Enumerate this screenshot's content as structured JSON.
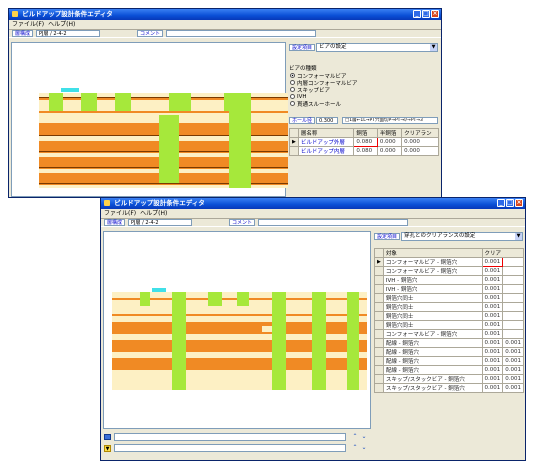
{
  "colors": {
    "copper": "#f08a24",
    "substrate": "#fdf0c4",
    "via": "#a6e83b",
    "stripe": "#7a3a00",
    "highlight": "#40e0e8"
  },
  "win1": {
    "title": "ビルドアップ設計条件エディタ",
    "menu": [
      "ファイル(F)",
      "ヘルプ(H)"
    ],
    "toolbar": {
      "tag": "層構成",
      "path": "PJ層 / 2-4-2",
      "comment_label": "コメント"
    },
    "right": {
      "setting_label": "設定項目",
      "setting_value": "ビアの設定",
      "via_group": "ビアの種類",
      "via_options": [
        "コンフォーマルビア",
        "内層コンフォーマルビア",
        "スキップビア",
        "IVH",
        "貫通スルーホール"
      ],
      "hole_label": "ホール径",
      "hole_value": "0.300",
      "hole_note": "□1層←1L→PT穴面切P→PT→I/→PT→3",
      "table_headers": [
        "層名称",
        "銅箔",
        "半銅箔",
        "クリアラン"
      ],
      "rows": [
        {
          "name": "ビルドアップ外層",
          "c1": "0.080",
          "c2": "0.000",
          "c3": "0.000"
        },
        {
          "name": "ビルドアップ内層",
          "c1": "0.080",
          "c2": "0.000",
          "c3": "0.000"
        }
      ]
    }
  },
  "win2": {
    "title": "ビルドアップ設計条件エディタ",
    "menu": [
      "ファイル(F)",
      "ヘルプ(H)"
    ],
    "toolbar": {
      "tag": "層構成",
      "path": "PJ層 / 2-4-2",
      "comment_label": "コメント"
    },
    "right": {
      "setting_label": "設定項目",
      "setting_value": "穿孔とのクリアランスの設定",
      "headers": [
        "対象",
        "クリア"
      ],
      "rows": [
        {
          "name": "コンフォーマルビア - 銅箔穴",
          "v": "0.001",
          "v2": ""
        },
        {
          "name": "コンフォーマルビア - 銅箔穴",
          "v": "0.001",
          "v2": ""
        },
        {
          "name": "IVH - 銅箔穴",
          "v": "0.001",
          "v2": ""
        },
        {
          "name": "IVH - 銅箔穴",
          "v": "0.001",
          "v2": ""
        },
        {
          "name": "銅箔穴同士",
          "v": "0.001",
          "v2": ""
        },
        {
          "name": "銅箔穴同士",
          "v": "0.001",
          "v2": ""
        },
        {
          "name": "銅箔穴同士",
          "v": "0.001",
          "v2": ""
        },
        {
          "name": "銅箔穴同士",
          "v": "0.001",
          "v2": ""
        },
        {
          "name": "コンフォーマルビア - 銅箔穴",
          "v": "0.001",
          "v2": ""
        },
        {
          "name": "配線 - 銅箔穴",
          "v": "0.001",
          "v2": "0.001"
        },
        {
          "name": "配線 - 銅箔穴",
          "v": "0.001",
          "v2": "0.001"
        },
        {
          "name": "配線 - 銅箔穴",
          "v": "0.001",
          "v2": "0.001"
        },
        {
          "name": "配線 - 銅箔穴",
          "v": "0.001",
          "v2": "0.001"
        },
        {
          "name": "スキップ/スタックビア - 銅箔穴",
          "v": "0.001",
          "v2": "0.001"
        },
        {
          "name": "スキップ/スタックビア - 銅箔穴",
          "v": "0.001",
          "v2": "0.001"
        }
      ]
    }
  }
}
